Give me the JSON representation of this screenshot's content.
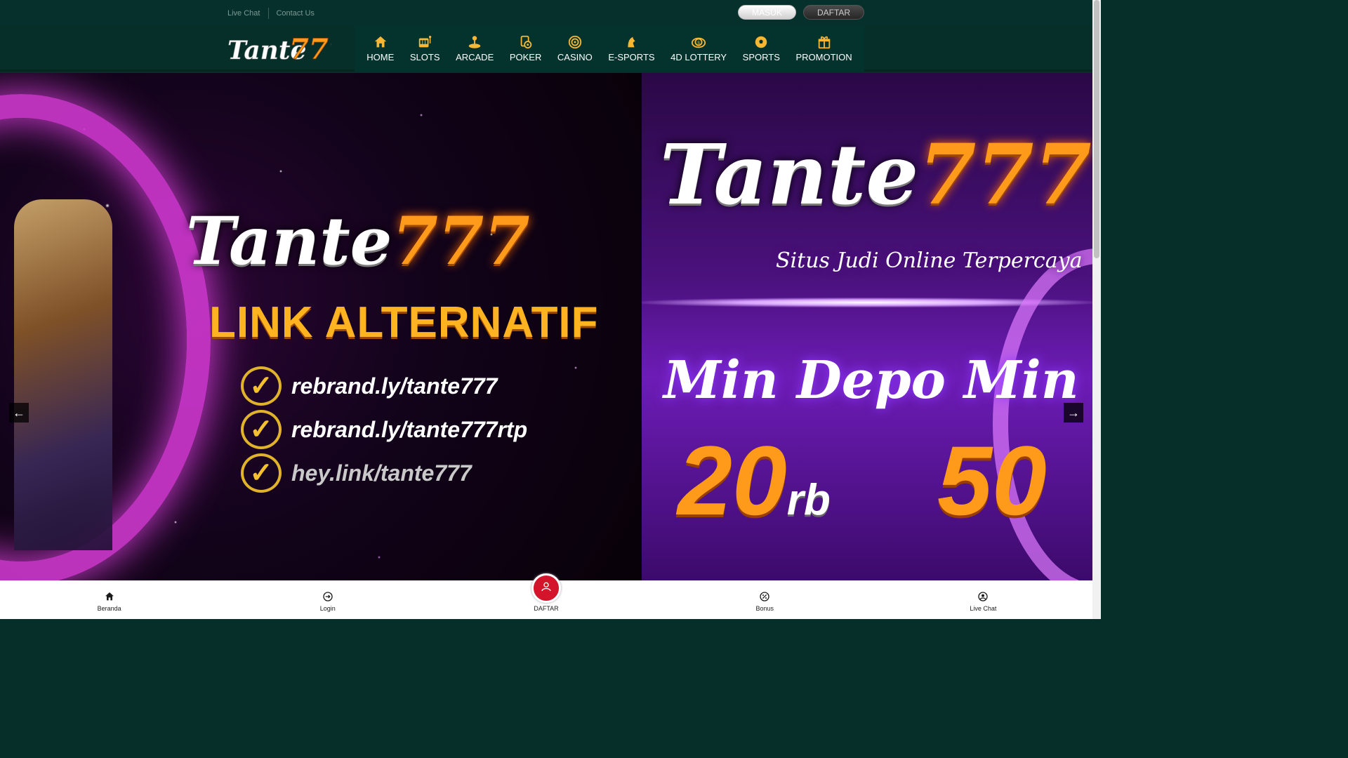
{
  "topbar": {
    "live_chat": "Live Chat",
    "contact_us": "Contact Us",
    "masuk": "MASUK",
    "daftar": "DAFTAR"
  },
  "logo": {
    "text_white": "Tante",
    "text_orange": "777"
  },
  "menu": [
    {
      "label": "HOME",
      "icon": "home-icon"
    },
    {
      "label": "SLOTS",
      "icon": "slot-machine-icon"
    },
    {
      "label": "ARCADE",
      "icon": "joystick-icon"
    },
    {
      "label": "POKER",
      "icon": "poker-chip-icon"
    },
    {
      "label": "CASINO",
      "icon": "roulette-icon"
    },
    {
      "label": "E-SPORTS",
      "icon": "esports-icon"
    },
    {
      "label": "4D LOTTERY",
      "icon": "lottery-ball-icon"
    },
    {
      "label": "SPORTS",
      "icon": "soccer-ball-icon"
    },
    {
      "label": "PROMOTION",
      "icon": "gift-icon"
    }
  ],
  "banner": {
    "slide1": {
      "brand_white": "Tante",
      "brand_orange": "777",
      "headline": "LINK ALTERNATIF",
      "links": [
        "rebrand.ly/tante777",
        "rebrand.ly/tante777rtp",
        "hey.link/tante777"
      ]
    },
    "slide2": {
      "brand_white": "Tante",
      "brand_orange": "777",
      "tagline": "Situs Judi Online Terpercaya",
      "promo_text": "Min Depo  Min W",
      "amount1": "20",
      "amount1_unit": "rb",
      "amount2": "50"
    }
  },
  "bottom_nav": [
    {
      "label": "Beranda",
      "icon": "home-icon"
    },
    {
      "label": "Login",
      "icon": "login-icon"
    },
    {
      "label": "DAFTAR",
      "icon": "user-avatar-icon"
    },
    {
      "label": "Bonus",
      "icon": "discount-icon"
    },
    {
      "label": "Live Chat",
      "icon": "headset-icon"
    }
  ],
  "colors": {
    "header_bg": "#062f2a",
    "menu_bg": "#04332d",
    "accent_orange": "#ff9a1a",
    "daftar_red": "#d4142a"
  }
}
